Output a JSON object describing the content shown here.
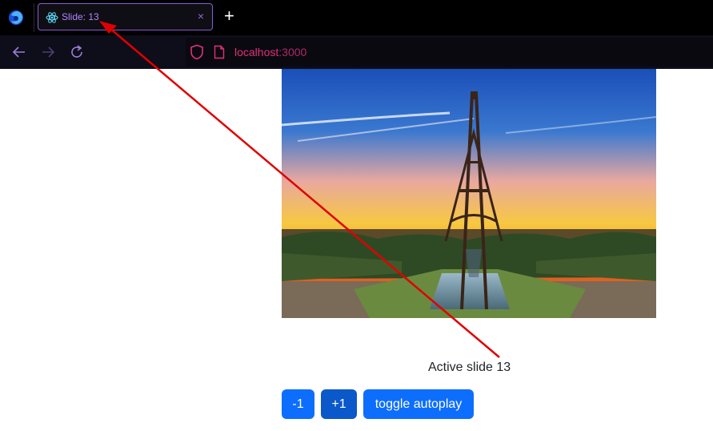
{
  "browser": {
    "tab_title": "Slide: 13",
    "tab_close": "×",
    "new_tab": "+",
    "url_host": "localhost",
    "url_port": ":3000"
  },
  "carousel": {
    "caption": "Active slide 13",
    "buttons": {
      "prev": "-1",
      "next": "+1",
      "toggle": "toggle autoplay"
    }
  },
  "colors": {
    "primary_button": "#0d6efd",
    "active_button": "#0a58ca",
    "annotation_arrow": "#e00000",
    "tab_accent": "#b184ff",
    "url_accent": "#e0307a"
  }
}
